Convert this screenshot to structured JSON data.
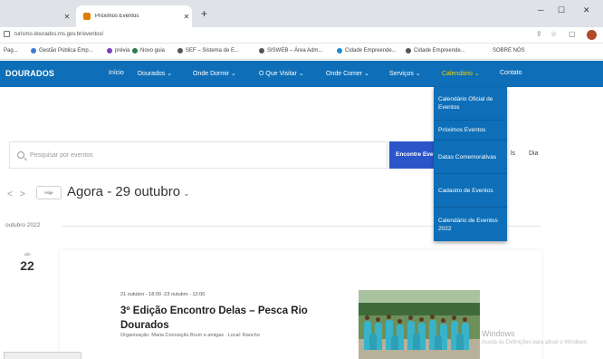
{
  "browser": {
    "tabs": [
      {
        "title": "",
        "active": false
      },
      {
        "title": "Próximos Eventos",
        "active": true
      }
    ],
    "url": "turismo.dourados.ms.gov.br/eventos/",
    "bookmarks": [
      {
        "label": "Pag...",
        "color": "#888888"
      },
      {
        "label": "Gestão Pública Emp...",
        "color": "#3a7ad6"
      },
      {
        "label": "prévia",
        "color": "#7b3fb8"
      },
      {
        "label": "Novo guia",
        "color": "#2b7a4b"
      },
      {
        "label": "SEF – Sistema de E...",
        "color": "#555555"
      },
      {
        "label": "SISWEB – Área Adm...",
        "color": "#555555"
      },
      {
        "label": "Cidade Empreende...",
        "color": "#1e8ad6"
      },
      {
        "label": "Cidade Empreende...",
        "color": "#555555"
      },
      {
        "label": "SOBRE NÓS",
        "color": "#ffffff"
      }
    ]
  },
  "site": {
    "logo": "DOURADOS",
    "nav": [
      {
        "label": "Início"
      },
      {
        "label": "Dourados ⌄"
      },
      {
        "label": "Onde Dormir ⌄"
      },
      {
        "label": "O Que Visitar ⌄"
      },
      {
        "label": "Onde Comer ⌄"
      },
      {
        "label": "Serviços ⌄"
      },
      {
        "label": "Calendário ⌄",
        "active": true
      },
      {
        "label": "Contato"
      }
    ],
    "dropdown": [
      "Calendário Oficial de Eventos",
      "Próximos Eventos",
      "Datas Comemorativas",
      "Cadastro de Eventos",
      "Calendário de Eventos 2022"
    ]
  },
  "events": {
    "search_placeholder": "Pesquisar por eventos",
    "find_button": "Encontre Eventos",
    "view_partial": "ls",
    "view_label": "Dia",
    "today_label": "Hoje",
    "range": "Agora - 29 outubro",
    "month_label": "outubro 2022",
    "day_of_week": "sáb",
    "day_number": "22",
    "item": {
      "time": "21 outubro - 18:00 -23 outubro - 12:00",
      "title": "3º Edição Encontro Delas – Pesca Rio Dourados",
      "description": "Organização: Maria Conceição Brum e amigas . Local: Rancho"
    }
  },
  "watermark": {
    "line1": "Windows",
    "line2": "Aceda às Definições para ativar o Windows."
  }
}
